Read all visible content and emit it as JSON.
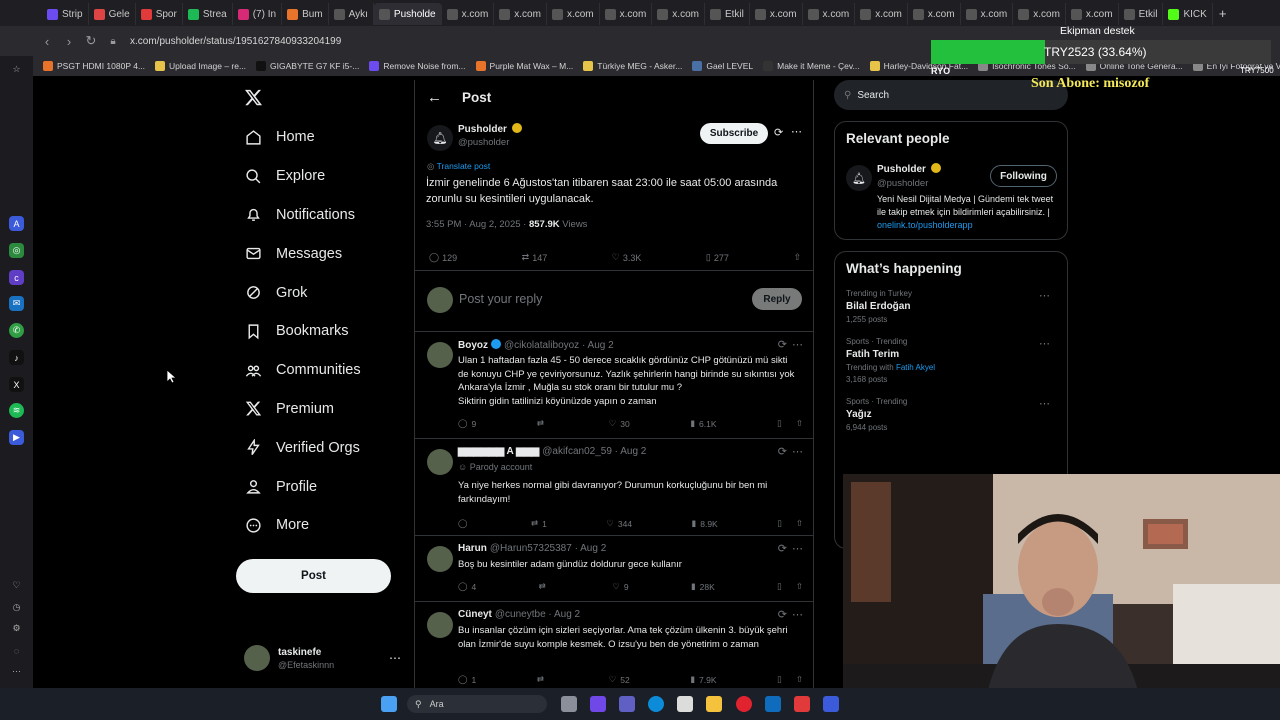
{
  "browser": {
    "tabs": [
      {
        "label": "Strip",
        "icon_color": "#6c4cf0"
      },
      {
        "label": "Gele",
        "icon_color": "#d44"
      },
      {
        "label": "Spor",
        "icon_color": "#e03a3a"
      },
      {
        "label": "Strea",
        "icon_color": "#1db954"
      },
      {
        "label": "(7) In",
        "icon_color": "#d62976"
      },
      {
        "label": "Bum",
        "icon_color": "#e8732a"
      },
      {
        "label": "Aykı",
        "icon_color": "#555"
      },
      {
        "label": "Pusholde",
        "icon_color": "#555"
      },
      {
        "label": "x.com",
        "icon_color": "#555"
      },
      {
        "label": "x.com",
        "icon_color": "#555"
      },
      {
        "label": "x.com",
        "icon_color": "#555"
      },
      {
        "label": "x.com",
        "icon_color": "#555"
      },
      {
        "label": "x.com",
        "icon_color": "#555"
      },
      {
        "label": "Etkil",
        "icon_color": "#555"
      },
      {
        "label": "x.com",
        "icon_color": "#555"
      },
      {
        "label": "x.com",
        "icon_color": "#555"
      },
      {
        "label": "x.com",
        "icon_color": "#555"
      },
      {
        "label": "x.com",
        "icon_color": "#555"
      },
      {
        "label": "x.com",
        "icon_color": "#555"
      },
      {
        "label": "x.com",
        "icon_color": "#555"
      },
      {
        "label": "x.com",
        "icon_color": "#555"
      },
      {
        "label": "Etkil",
        "icon_color": "#555"
      },
      {
        "label": "KICK",
        "icon_color": "#53fc18"
      }
    ],
    "url": "x.com/pusholder/status/1951627840933204199",
    "bookmarks": [
      {
        "label": "PSGT HDMI 1080P 4...",
        "color": "#e8732a"
      },
      {
        "label": "Upload Image – re...",
        "color": "#e8c34a"
      },
      {
        "label": "GIGABYTE G7 KF i5-...",
        "color": "#111"
      },
      {
        "label": "Remove Noise from...",
        "color": "#6c4cf0"
      },
      {
        "label": "Purple Mat Wax – M...",
        "color": "#e8732a"
      },
      {
        "label": "Türkiye MEG - Asker...",
        "color": "#e8c34a"
      },
      {
        "label": "Gael LEVEL",
        "color": "#4a6fa5"
      },
      {
        "label": "Make it Meme - Çev...",
        "color": "#333"
      },
      {
        "label": "Harley-Davidson Fat...",
        "color": "#e8c34a"
      },
      {
        "label": "Isochronic Tones So...",
        "color": "#888"
      },
      {
        "label": "Online Tone Genera...",
        "color": "#888"
      },
      {
        "label": "En İyi Fotoğraf ve Vi...",
        "color": "#888"
      }
    ]
  },
  "overlay": {
    "donation_title": "Ekipman destek",
    "donation_amount": "TRY2523 (33.64%)",
    "donation_progress": 0.3364,
    "donation_goal": "TRY7500",
    "donation_start": "RYO",
    "last_subscriber": "Son Abone: misozof"
  },
  "nav": {
    "items": [
      {
        "label": "Home",
        "icon": "home-icon"
      },
      {
        "label": "Explore",
        "icon": "search-icon"
      },
      {
        "label": "Notifications",
        "icon": "bell-icon"
      },
      {
        "label": "Messages",
        "icon": "mail-icon"
      },
      {
        "label": "Grok",
        "icon": "grok-icon"
      },
      {
        "label": "Bookmarks",
        "icon": "bookmark-icon"
      },
      {
        "label": "Communities",
        "icon": "communities-icon"
      },
      {
        "label": "Premium",
        "icon": "x-logo-icon"
      },
      {
        "label": "Verified Orgs",
        "icon": "lightning-icon"
      },
      {
        "label": "Profile",
        "icon": "person-icon"
      },
      {
        "label": "More",
        "icon": "more-circle-icon"
      }
    ],
    "post_button": "Post",
    "account_name": "taskinefe",
    "account_handle": "@Efetaskinnn"
  },
  "post": {
    "header": "Post",
    "author_name": "Pusholder",
    "author_handle": "@pusholder",
    "subscribe": "Subscribe",
    "translate": "Translate post",
    "text": "İzmir genelinde 6 Ağustos'tan itibaren saat 23:00 ile saat 05:00 arasında zorunlu su kesintileri uygulanacak.",
    "time": "3:55 PM · Aug 2, 2025 · ",
    "views_count": "857.9K",
    "views_label": " Views",
    "replies": "129",
    "reposts": "147",
    "likes": "3.3K",
    "bookmarks": "277",
    "reply_placeholder": "Post your reply",
    "reply_button": "Reply"
  },
  "replies": [
    {
      "name": "Boyoz",
      "handle": "@cikolataliboyoz · Aug 2",
      "verified": true,
      "parody": "",
      "text": "Ulan 1 haftadan fazla 45 - 50 derece sıcaklık gördünüz CHP götünüzü mü sikti de konuyu CHP ye çeviriyorsunuz. Yazlık şehirlerin hangi birinde su sıkıntısı yok Ankara'yla İzmir , Muğla su stok oranı bir tutulur mu ?\nSiktirin gidin tatilinizi köyünüzde yapın o zaman",
      "replies": "9",
      "reposts": "",
      "likes": "30",
      "views": "6.1K"
    },
    {
      "name": "▆▆▆▆▆▆ A ▆▆▆",
      "handle": "@akifcan02_59 · Aug 2",
      "verified": false,
      "parody": "Parody account",
      "text": "Ya niye herkes normal gibi davranıyor? Durumun korkuçluğunu bir ben mi farkındayım!",
      "replies": "",
      "reposts": "1",
      "likes": "344",
      "views": "8.9K"
    },
    {
      "name": "Harun",
      "handle": "@Harun57325387 · Aug 2",
      "verified": false,
      "parody": "",
      "text": "Boş bu kesintiler adam gündüz doldurur gece kullanır",
      "replies": "4",
      "reposts": "",
      "likes": "9",
      "views": "28K"
    },
    {
      "name": "Cüneyt",
      "handle": "@cuneytbe · Aug 2",
      "verified": false,
      "parody": "",
      "text": "Bu insanlar çözüm için sizleri seçiyorlar. Ama tek çözüm ülkenin 3. büyük şehri olan İzmir'de suyu komple kesmek. O izsu'yu ben de yönetirim o zaman",
      "replies": "1",
      "reposts": "",
      "likes": "52",
      "views": "7.9K"
    }
  ],
  "sidebar": {
    "search_placeholder": "Search",
    "relevant_title": "Relevant people",
    "person_name": "Pusholder",
    "person_handle": "@pusholder",
    "follow_button": "Following",
    "person_bio": "Yeni Nesil Dijital Medya | Gündemi tek tweet ile takip etmek için bildirimleri açabilirsiniz. | ",
    "person_link": "onelink.to/pusholderapp",
    "happening_title": "What’s happening",
    "trends": [
      {
        "category": "Trending in Turkey",
        "title": "Bilal Erdoğan",
        "with_label": "",
        "with_link": "",
        "count": "1,255 posts"
      },
      {
        "category": "Sports · Trending",
        "title": "Fatih Terim",
        "with_label": "Trending with ",
        "with_link": "Fatih Akyel",
        "count": "3,168 posts"
      },
      {
        "category": "Sports · Trending",
        "title": "Yağız",
        "with_label": "",
        "with_link": "",
        "count": "6,944 posts"
      }
    ]
  },
  "taskbar": {
    "search_label": "Ara"
  },
  "colors": {
    "accent": "#1d9bf0",
    "verified": "#e2b719",
    "donation_fill": "#22c03c",
    "subscriber_text": "#f2e85a"
  }
}
